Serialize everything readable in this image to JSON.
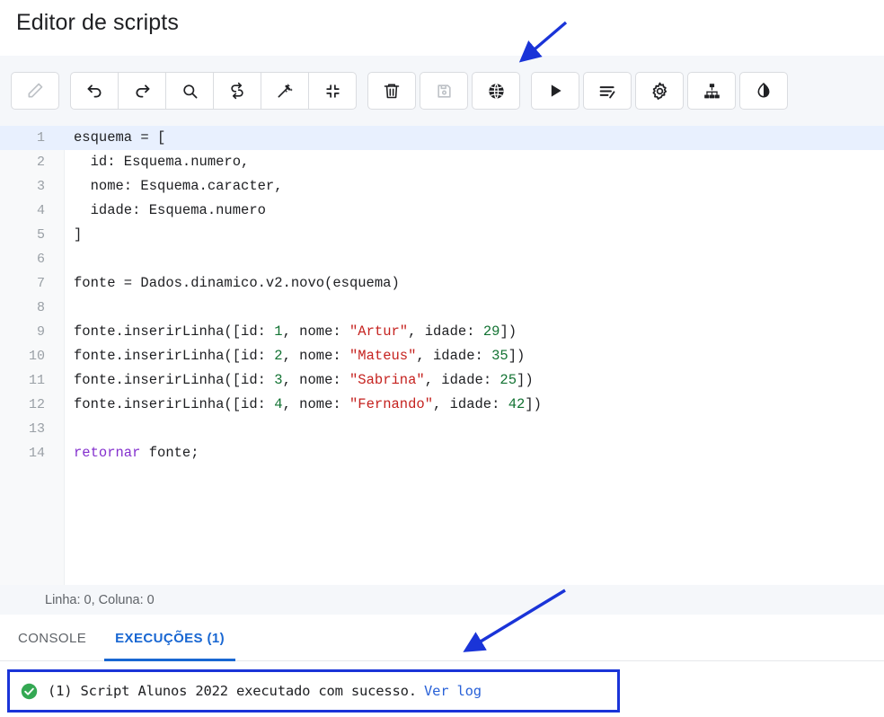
{
  "page_title": "Editor de scripts",
  "toolbar": {
    "buttons": [
      {
        "name": "edit-button",
        "icon": "pencil-icon",
        "title": "Editar",
        "disabled": true
      },
      {
        "name": "undo-button",
        "icon": "undo-icon",
        "title": "Desfazer",
        "disabled": false
      },
      {
        "name": "redo-button",
        "icon": "redo-icon",
        "title": "Refazer",
        "disabled": false
      },
      {
        "name": "find-button",
        "icon": "search-icon",
        "title": "Pesquisar",
        "disabled": false
      },
      {
        "name": "replace-button",
        "icon": "replace-icon",
        "title": "Substituir",
        "disabled": false
      },
      {
        "name": "format-button",
        "icon": "magic-wand-icon",
        "title": "Formatar",
        "disabled": false
      },
      {
        "name": "fullscreen-button",
        "icon": "compress-icon",
        "title": "Tela cheia",
        "disabled": false
      },
      {
        "name": "delete-button",
        "icon": "trash-icon",
        "title": "Excluir",
        "disabled": false
      },
      {
        "name": "save-button",
        "icon": "floppy-disk-icon",
        "title": "Salvar",
        "disabled": true
      },
      {
        "name": "deploy-button",
        "icon": "globe-icon",
        "title": "Implantar",
        "disabled": false
      },
      {
        "name": "run-button",
        "icon": "play-icon",
        "title": "Executar",
        "disabled": false
      },
      {
        "name": "log-button",
        "icon": "list-edit-icon",
        "title": "Registro",
        "disabled": false
      },
      {
        "name": "settings-button",
        "icon": "gear-icon",
        "title": "Configuracoes",
        "disabled": false
      },
      {
        "name": "hierarchy-button",
        "icon": "sitemap-icon",
        "title": "Hierarquia",
        "disabled": false
      },
      {
        "name": "contrast-button",
        "icon": "contrast-icon",
        "title": "Contraste",
        "disabled": false
      }
    ]
  },
  "editor": {
    "active_line": 1,
    "lines": [
      {
        "n": "1",
        "tokens": [
          {
            "t": "esquema = [",
            "c": ""
          }
        ]
      },
      {
        "n": "2",
        "tokens": [
          {
            "t": "  id: Esquema.numero,",
            "c": ""
          }
        ]
      },
      {
        "n": "3",
        "tokens": [
          {
            "t": "  nome: Esquema.caracter,",
            "c": ""
          }
        ]
      },
      {
        "n": "4",
        "tokens": [
          {
            "t": "  idade: Esquema.numero",
            "c": ""
          }
        ]
      },
      {
        "n": "5",
        "tokens": [
          {
            "t": "]",
            "c": ""
          }
        ]
      },
      {
        "n": "6",
        "tokens": []
      },
      {
        "n": "7",
        "tokens": [
          {
            "t": "fonte = Dados.dinamico.v2.novo(esquema)",
            "c": ""
          }
        ]
      },
      {
        "n": "8",
        "tokens": []
      },
      {
        "n": "9",
        "tokens": [
          {
            "t": "fonte.inserirLinha([id: ",
            "c": ""
          },
          {
            "t": "1",
            "c": "tok-num"
          },
          {
            "t": ", nome: ",
            "c": ""
          },
          {
            "t": "\"Artur\"",
            "c": "tok-str"
          },
          {
            "t": ", idade: ",
            "c": ""
          },
          {
            "t": "29",
            "c": "tok-num"
          },
          {
            "t": "])",
            "c": ""
          }
        ]
      },
      {
        "n": "10",
        "tokens": [
          {
            "t": "fonte.inserirLinha([id: ",
            "c": ""
          },
          {
            "t": "2",
            "c": "tok-num"
          },
          {
            "t": ", nome: ",
            "c": ""
          },
          {
            "t": "\"Mateus\"",
            "c": "tok-str"
          },
          {
            "t": ", idade: ",
            "c": ""
          },
          {
            "t": "35",
            "c": "tok-num"
          },
          {
            "t": "])",
            "c": ""
          }
        ]
      },
      {
        "n": "11",
        "tokens": [
          {
            "t": "fonte.inserirLinha([id: ",
            "c": ""
          },
          {
            "t": "3",
            "c": "tok-num"
          },
          {
            "t": ", nome: ",
            "c": ""
          },
          {
            "t": "\"Sabrina\"",
            "c": "tok-str"
          },
          {
            "t": ", idade: ",
            "c": ""
          },
          {
            "t": "25",
            "c": "tok-num"
          },
          {
            "t": "])",
            "c": ""
          }
        ]
      },
      {
        "n": "12",
        "tokens": [
          {
            "t": "fonte.inserirLinha([id: ",
            "c": ""
          },
          {
            "t": "4",
            "c": "tok-num"
          },
          {
            "t": ", nome: ",
            "c": ""
          },
          {
            "t": "\"Fernando\"",
            "c": "tok-str"
          },
          {
            "t": ", idade: ",
            "c": ""
          },
          {
            "t": "42",
            "c": "tok-num"
          },
          {
            "t": "])",
            "c": ""
          }
        ]
      },
      {
        "n": "13",
        "tokens": []
      },
      {
        "n": "14",
        "tokens": [
          {
            "t": "retornar",
            "c": "tok-kw"
          },
          {
            "t": " fonte;",
            "c": ""
          }
        ]
      }
    ]
  },
  "status_line": "Linha: 0, Coluna: 0",
  "tabs": [
    {
      "name": "tab-console",
      "label": "CONSOLE",
      "active": false
    },
    {
      "name": "tab-execucoes",
      "label": "EXECUÇÕES (1)",
      "active": true
    }
  ],
  "result": {
    "icon": "success-check-icon",
    "message": "(1) Script Alunos 2022 executado com sucesso.",
    "link_label": "Ver log"
  },
  "colors": {
    "accent_blue": "#1967d2",
    "annotation_blue": "#1a34d8",
    "success_green": "#34a853",
    "string_red": "#c5221f",
    "number_green": "#137333",
    "keyword_purple": "#8430ce",
    "active_line_bg": "#e8f0fe",
    "toolbar_bg": "#f5f7fa"
  },
  "annotations": [
    {
      "name": "arrow-to-run-button",
      "points_to": "run-button"
    },
    {
      "name": "arrow-to-result-banner",
      "points_to": "result-banner"
    }
  ]
}
